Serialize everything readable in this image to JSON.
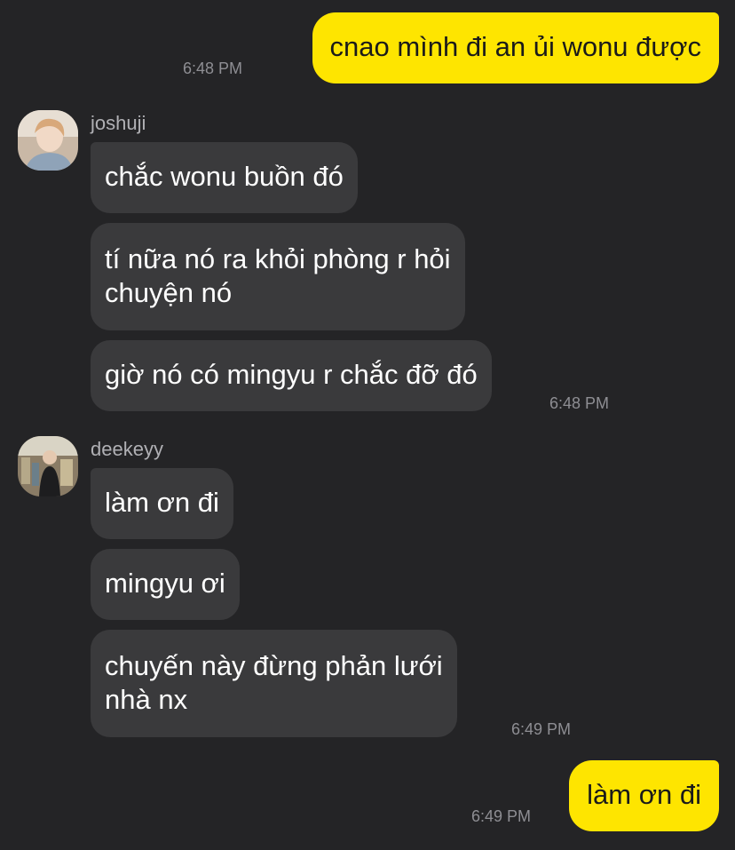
{
  "chat": {
    "messages": [
      {
        "text": "cnao mình đi an ủi wonu được"
      },
      {
        "text": "chắc wonu buồn đó"
      },
      {
        "text": "tí nữa nó ra khỏi phòng r hỏi\nchuyện nó"
      },
      {
        "text": "giờ nó có mingyu r chắc đỡ đó"
      },
      {
        "text": "làm ơn đi"
      },
      {
        "text": "mingyu ơi"
      },
      {
        "text": "chuyến này đừng phản lưới\nnhà nx"
      },
      {
        "text": "làm ơn đi"
      }
    ],
    "times": [
      "6:48 PM",
      "6:48 PM",
      "6:49 PM",
      "6:49 PM"
    ],
    "senders": [
      {
        "name": "joshuji",
        "avatar_icon": "user-avatar-photo"
      },
      {
        "name": "deekeyy",
        "avatar_icon": "user-avatar-photo"
      }
    ]
  },
  "colors": {
    "background": "#242426",
    "incoming_bubble": "#3a3a3c",
    "outgoing_bubble": "#fee500",
    "timestamp": "#8e8e93"
  }
}
